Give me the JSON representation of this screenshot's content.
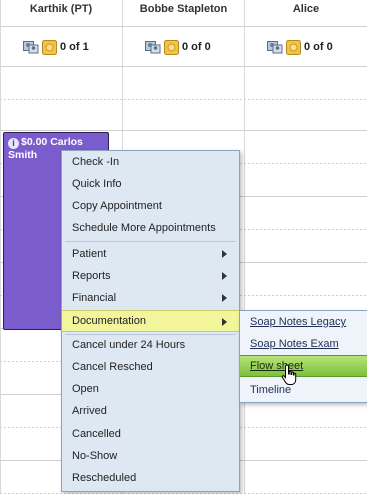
{
  "columns": [
    {
      "name": "Karthik (PT)",
      "count": "0 of 1"
    },
    {
      "name": "Bobbe Stapleton",
      "count": "0 of 0"
    },
    {
      "name": "Alice",
      "count": "0 of 0"
    }
  ],
  "appointment": {
    "line1": "$0.00 Carlos",
    "line2": "Smith",
    "color": "#7b5ccc"
  },
  "context_menu": {
    "items": [
      {
        "label": "Check -In"
      },
      {
        "label": "Quick Info"
      },
      {
        "label": "Copy Appointment"
      },
      {
        "label": "Schedule More Appointments"
      },
      {
        "label": "Patient",
        "submenu": true
      },
      {
        "label": "Reports",
        "submenu": true
      },
      {
        "label": "Financial",
        "submenu": true
      },
      {
        "label": "Documentation",
        "submenu": true,
        "highlighted": true
      },
      {
        "label": "Cancel under 24 Hours"
      },
      {
        "label": "Cancel Resched"
      },
      {
        "label": "Open"
      },
      {
        "label": "Arrived"
      },
      {
        "label": "Cancelled"
      },
      {
        "label": "No-Show"
      },
      {
        "label": "Rescheduled"
      }
    ]
  },
  "submenu": {
    "items": [
      {
        "label": "Soap Notes Legacy"
      },
      {
        "label": "Soap Notes Exam"
      },
      {
        "label": "Flow sheet",
        "highlighted": true
      },
      {
        "label": "Timeline"
      }
    ]
  },
  "colors": {
    "menu_bg": "#dde8f3",
    "menu_highlight": "#f2f59b",
    "submenu_highlight": "#7cc13a",
    "appointment": "#7b5ccc"
  }
}
